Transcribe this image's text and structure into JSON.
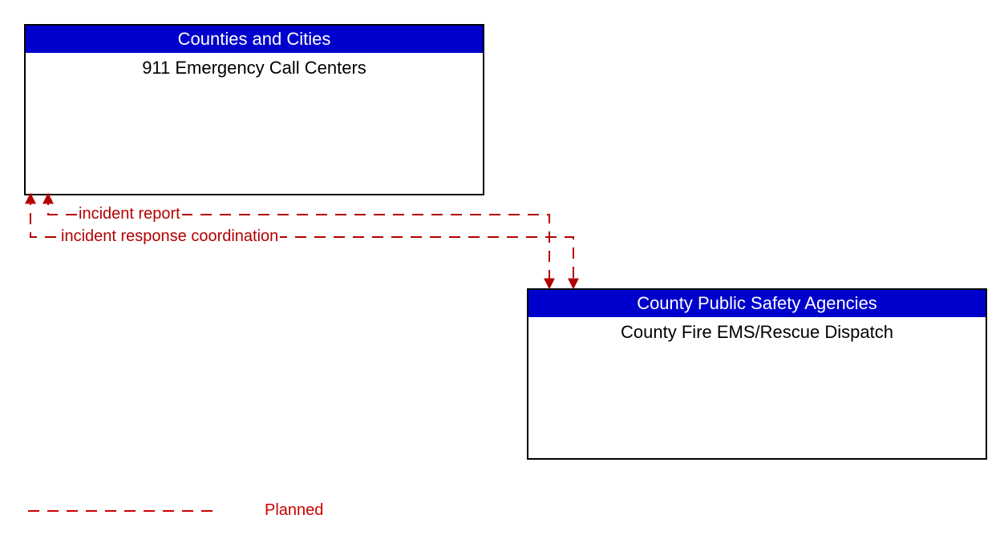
{
  "boxes": {
    "top": {
      "header": "Counties and Cities",
      "body": "911 Emergency Call Centers"
    },
    "bottom": {
      "header": "County Public Safety Agencies",
      "body": "County Fire EMS/Rescue Dispatch"
    }
  },
  "flows": {
    "incident_report": "incident report",
    "incident_response_coordination": "incident response coordination"
  },
  "legend": {
    "planned": "Planned"
  },
  "colors": {
    "header_bg": "#0000cc",
    "header_fg": "#ffffff",
    "planned_line": "#b30000"
  }
}
